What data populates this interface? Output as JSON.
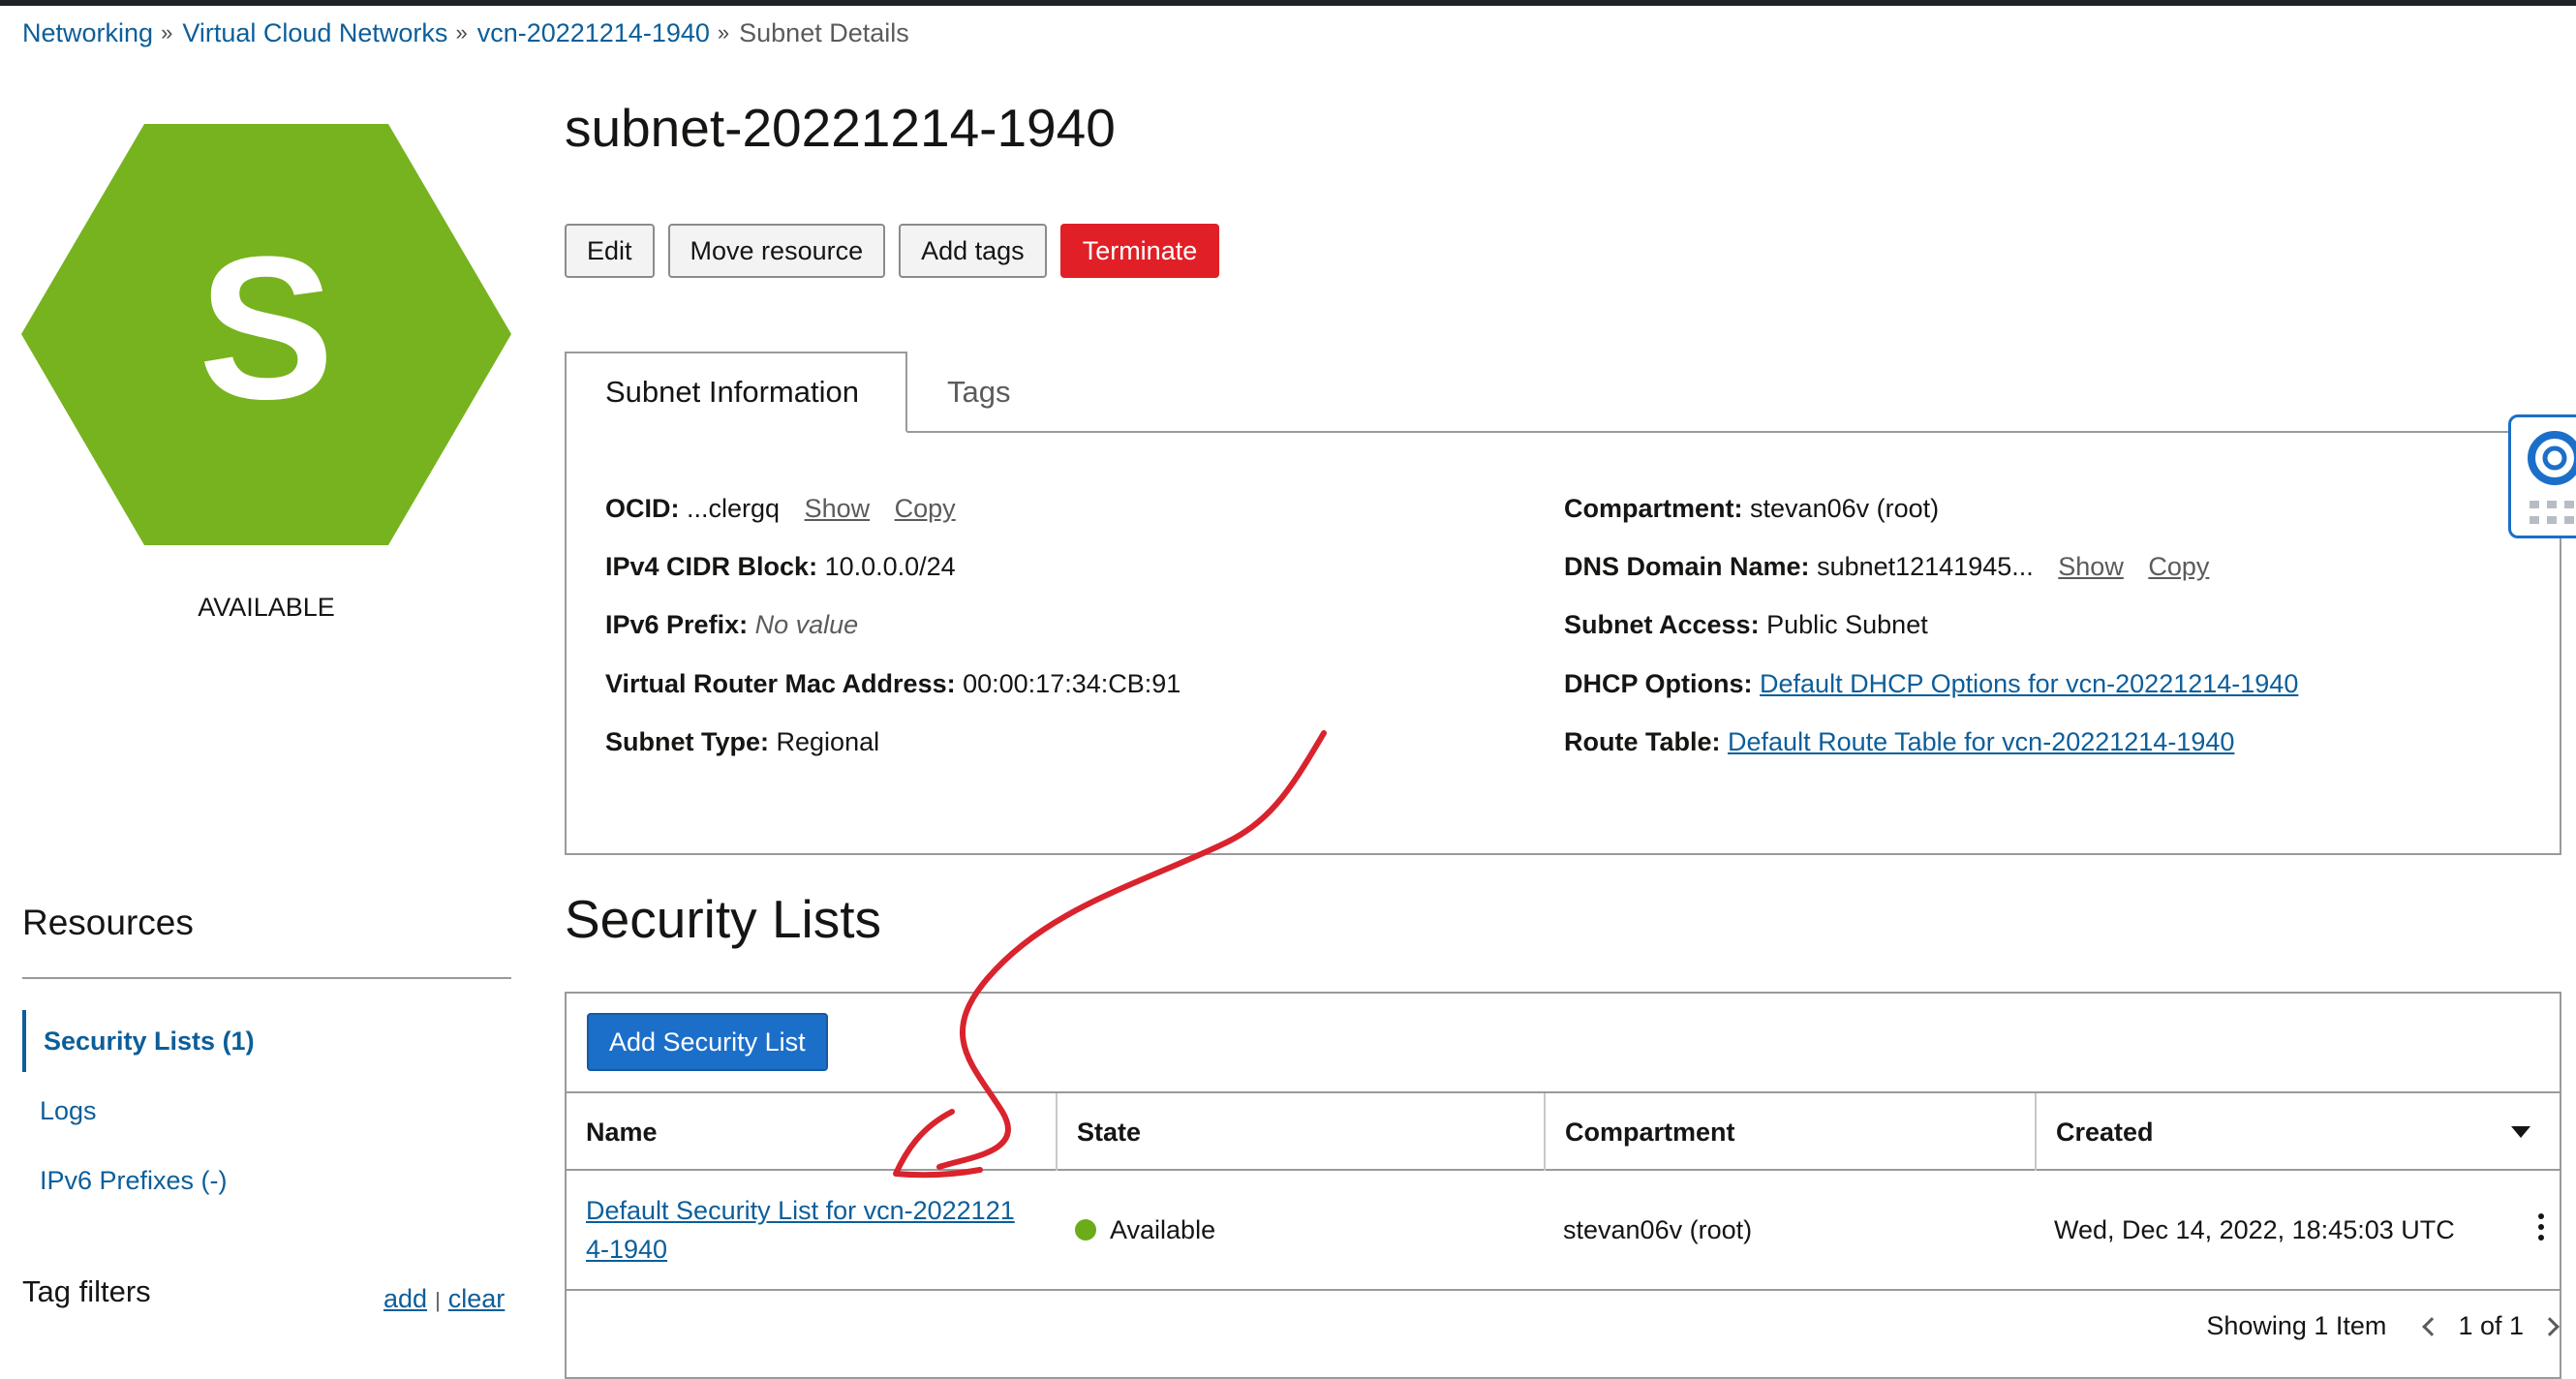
{
  "breadcrumb": {
    "items": [
      "Networking",
      "Virtual Cloud Networks",
      "vcn-20221214-1940"
    ],
    "current": "Subnet Details",
    "separator": "»"
  },
  "resource_icon": {
    "letter": "S",
    "color": "#76b31f",
    "status": "AVAILABLE"
  },
  "page_title": "subnet-20221214-1940",
  "actions": {
    "edit": "Edit",
    "move": "Move resource",
    "add_tags": "Add tags",
    "terminate": "Terminate"
  },
  "tabs": {
    "info": "Subnet Information",
    "tags": "Tags"
  },
  "info": {
    "ocid_label": "OCID:",
    "ocid_value": "...clergq",
    "show": "Show",
    "copy": "Copy",
    "ipv4_label": "IPv4 CIDR Block:",
    "ipv4_value": "10.0.0.0/24",
    "ipv6_label": "IPv6 Prefix:",
    "ipv6_value": "No value",
    "mac_label": "Virtual Router Mac Address:",
    "mac_value": "00:00:17:34:CB:91",
    "type_label": "Subnet Type:",
    "type_value": "Regional",
    "compartment_label": "Compartment:",
    "compartment_value": "stevan06v (root)",
    "dns_label": "DNS Domain Name:",
    "dns_value": "subnet12141945...",
    "access_label": "Subnet Access:",
    "access_value": "Public Subnet",
    "dhcp_label": "DHCP Options:",
    "dhcp_value": "Default DHCP Options for vcn-20221214-1940",
    "route_label": "Route Table:",
    "route_value": "Default Route Table for vcn-20221214-1940"
  },
  "resources": {
    "title": "Resources",
    "items": [
      "Security Lists (1)",
      "Logs",
      "IPv6 Prefixes (-)"
    ],
    "tag_filters": "Tag filters",
    "add": "add",
    "sep": "|",
    "clear": "clear"
  },
  "security_lists": {
    "title": "Security Lists",
    "add_button": "Add Security List",
    "columns": [
      "Name",
      "State",
      "Compartment",
      "Created"
    ],
    "row": {
      "name_line1": "Default Security List for vcn-2022121",
      "name_line2": "4-1940",
      "state": "Available",
      "state_color": "#6cab19",
      "compartment": "stevan06v (root)",
      "created": "Wed, Dec 14, 2022, 18:45:03 UTC"
    },
    "showing": "Showing 1 Item",
    "page": "1 of 1"
  },
  "annotation_color": "#d9232d"
}
